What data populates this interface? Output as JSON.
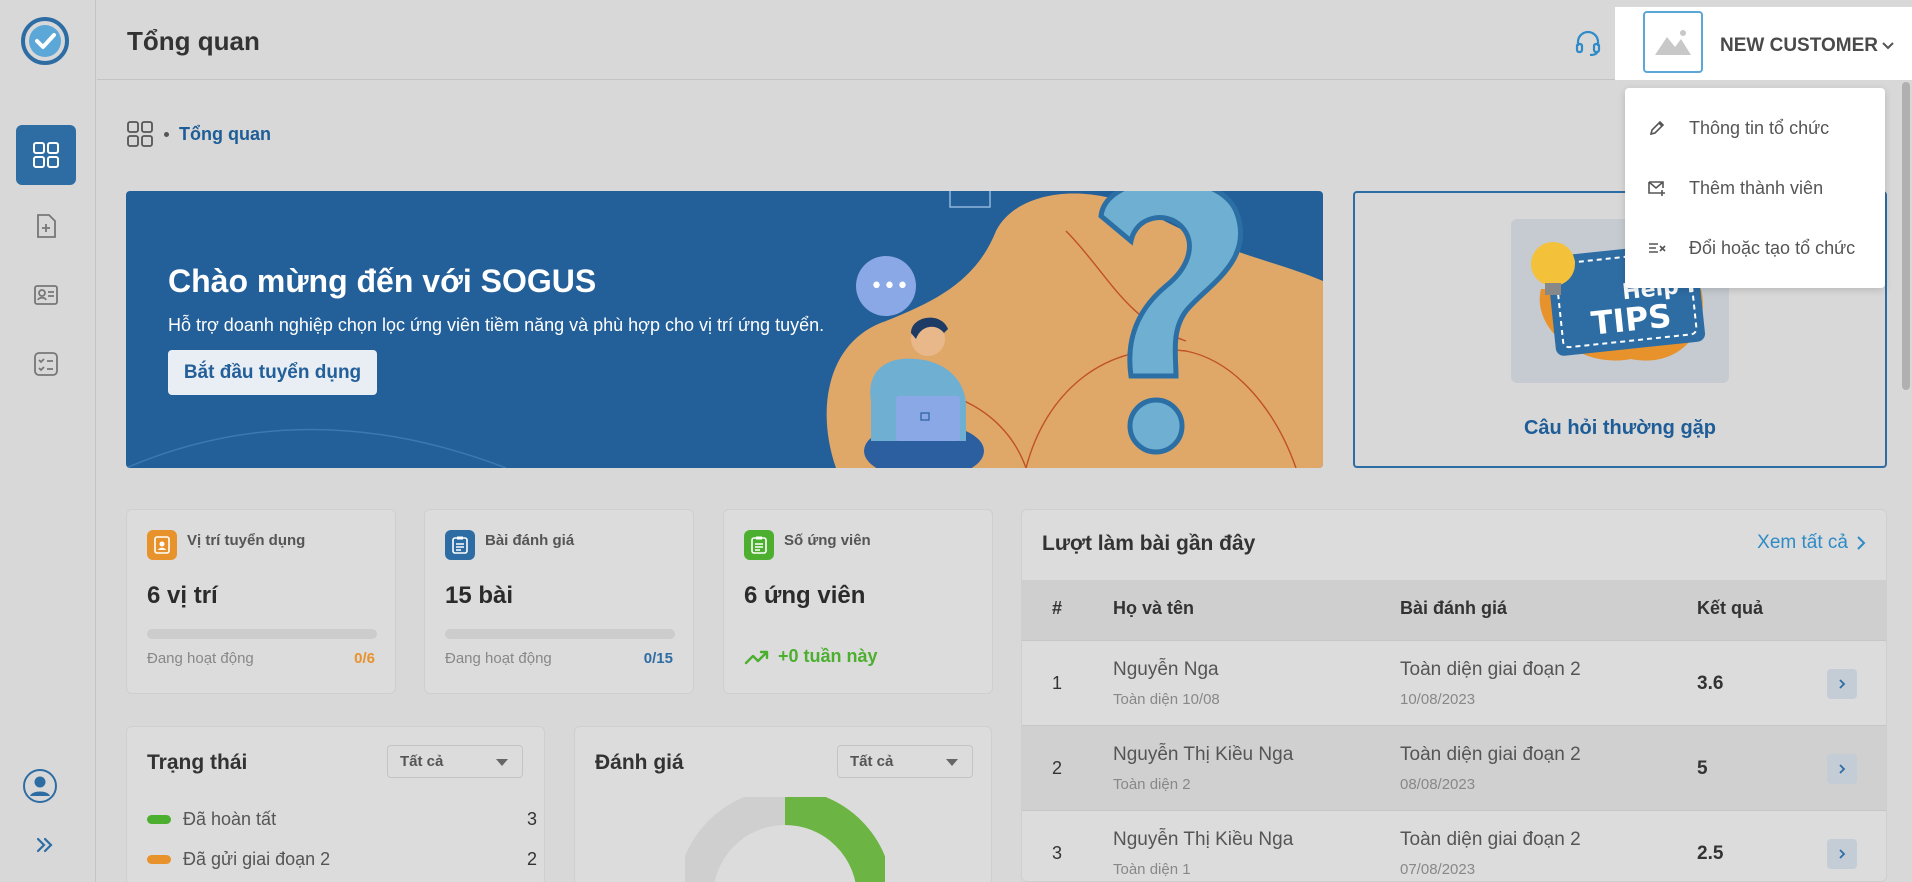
{
  "app": {
    "title": "Tổng quan"
  },
  "header": {
    "user_name": "NEW CUSTOMER"
  },
  "breadcrumb": {
    "current": "Tổng quan"
  },
  "hero": {
    "title": "Chào mừng đến với SOGUS",
    "subtitle": "Hỗ trợ doanh nghiệp chọn lọc ứng viên tiềm năng và phù hợp cho vị trí ứng tuyển.",
    "button": "Bắt đầu tuyển dụng"
  },
  "faq": {
    "label": "Câu hỏi thường gặp",
    "image_text_1": "Help f",
    "image_text_2": "TIPS"
  },
  "dropdown": {
    "items": [
      {
        "label": "Thông tin tổ chức",
        "icon": "pencil-icon"
      },
      {
        "label": "Thêm thành viên",
        "icon": "mail-add-icon"
      },
      {
        "label": "Đổi hoặc tạo tổ chức",
        "icon": "list-switch-icon"
      }
    ]
  },
  "stats": [
    {
      "label": "Vị trí tuyển dụng",
      "value": "6 vị trí",
      "footer": "Đang hoạt động",
      "ratio": "0/6",
      "color": "#e8922c",
      "icon": "person-badge-icon"
    },
    {
      "label": "Bài đánh giá",
      "value": "15 bài",
      "footer": "Đang hoạt động",
      "ratio": "0/15",
      "color": "#2e6da4",
      "icon": "clipboard-icon"
    },
    {
      "label": "Số ứng viên",
      "value": "6 ứng viên",
      "trend": "+0 tuần này",
      "color": "#4caf30",
      "icon": "clipboard-icon"
    }
  ],
  "recent": {
    "title": "Lượt làm bài gần đây",
    "see_all": "Xem tất cả",
    "columns": [
      "#",
      "Họ và tên",
      "Bài đánh giá",
      "Kết quả"
    ],
    "rows": [
      {
        "idx": "1",
        "name": "Nguyễn Nga",
        "sub": "Toàn diện 10/08",
        "test": "Toàn diện giai đoạn 2",
        "date": "10/08/2023",
        "score": "3.6"
      },
      {
        "idx": "2",
        "name": "Nguyễn Thị Kiều Nga",
        "sub": "Toàn diện 2",
        "test": "Toàn diện giai đoạn 2",
        "date": "08/08/2023",
        "score": "5"
      },
      {
        "idx": "3",
        "name": "Nguyễn Thị Kiều Nga",
        "sub": "Toàn diện 1",
        "test": "Toàn diện giai đoạn 2",
        "date": "07/08/2023",
        "score": "2.5"
      }
    ]
  },
  "status_panel": {
    "title": "Trạng thái",
    "filter": "Tất cả",
    "items": [
      {
        "label": "Đã hoàn tất",
        "count": "3",
        "color": "#4caf30"
      },
      {
        "label": "Đã gửi giai đoạn 2",
        "count": "2",
        "color": "#e8922c"
      }
    ]
  },
  "rating_panel": {
    "title": "Đánh giá",
    "filter": "Tất cả",
    "ring_color": "#6cb544"
  }
}
